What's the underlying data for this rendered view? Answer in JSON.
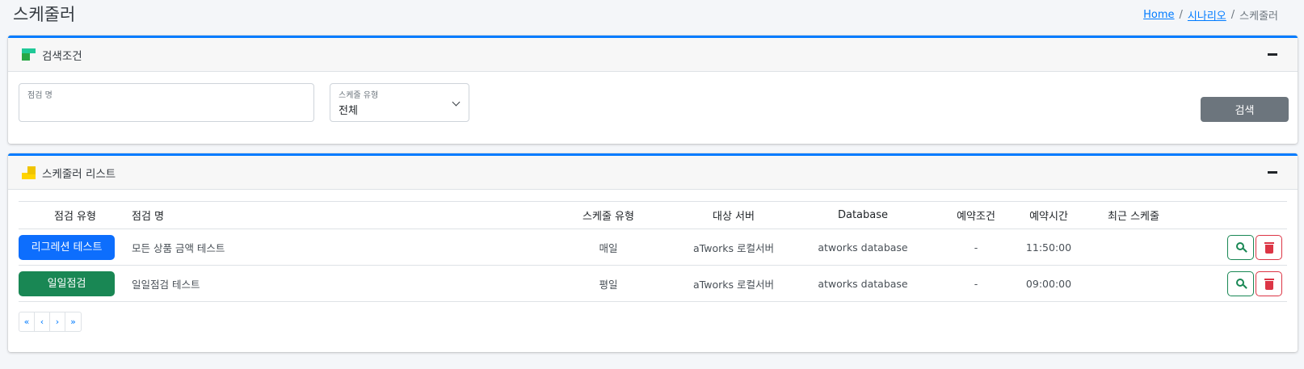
{
  "page": {
    "title": "스케줄러"
  },
  "breadcrumb": {
    "home": "Home",
    "scenario": "시나리오",
    "current": "스케줄러",
    "sep": "/"
  },
  "search_card": {
    "title": "검색조건",
    "name_field": {
      "label": "점검 명",
      "value": "",
      "placeholder": ""
    },
    "type_field": {
      "label": "스케줄 유형",
      "value": "전체"
    },
    "search_button": "검색"
  },
  "list_card": {
    "title": "스케줄러 리스트",
    "columns": [
      "점검 유형",
      "점검 명",
      "스케줄 유형",
      "대상 서버",
      "Database",
      "예약조건",
      "예약시간",
      "최근 스케줄"
    ],
    "rows": [
      {
        "type": "리그레션 테스트",
        "type_color": "#0d6efd",
        "name": "모든 상품 금액 테스트",
        "schedule": "매일",
        "server": "aTworks 로컬서버",
        "database": "atworks database",
        "condition": "-",
        "time": "11:50:00",
        "recent": ""
      },
      {
        "type": "일일점검",
        "type_color": "#198754",
        "name": "일일점검 테스트",
        "schedule": "평일",
        "server": "aTworks 로컬서버",
        "database": "atworks database",
        "condition": "-",
        "time": "09:00:00",
        "recent": ""
      }
    ],
    "pager": {
      "first": "«",
      "prev": "‹",
      "next": "›",
      "last": "»"
    }
  },
  "colors": {
    "accent": "#007bff",
    "view": "#198754",
    "delete": "#dc3545",
    "search_button": "#6c757d"
  },
  "icons": {
    "search_card": "search-condition-icon",
    "list_card": "list-icon",
    "view": "magnifier-icon",
    "delete": "trash-icon",
    "collapse": "minus-icon"
  }
}
